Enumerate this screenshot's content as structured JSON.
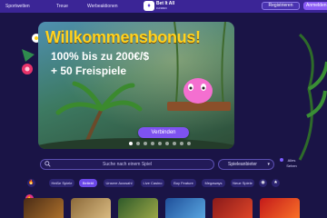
{
  "nav": {
    "items": [
      "Sportwetten",
      "Treue",
      "Werbeaktionen"
    ],
    "logo_text": "Bet It All",
    "logo_sub": "CASINO",
    "register_label": "Registrieren",
    "login_label": "Anmelden"
  },
  "hero": {
    "title": "Willkommensbonus!",
    "line1": "100% bis zu 200€/$",
    "line2": "+ 50 Freispiele",
    "cta_label": "Verbinden",
    "slides": 9,
    "active_slide": 0
  },
  "search": {
    "placeholder": "Suche nach einem Spiel",
    "provider_label": "Spieleanbieter",
    "see_all_label": "Alles Sehen"
  },
  "categories": [
    "Heiße Spiele",
    "Beliebt",
    "Unsere Auswahl",
    "Live Casino",
    "Buy Feature",
    "Megaways",
    "Neue Spiele"
  ],
  "colors": {
    "background": "#1a1446",
    "nav": "#3b2596",
    "accent": "#7e52f0",
    "title_yellow": "#ffd21f"
  }
}
